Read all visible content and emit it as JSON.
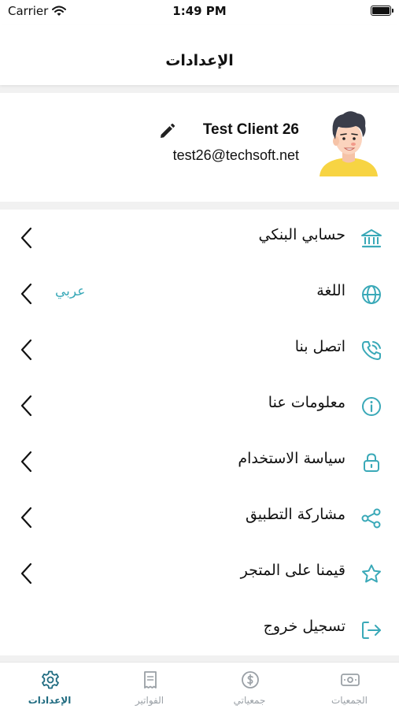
{
  "status_bar": {
    "carrier": "Carrier",
    "time": "1:49 PM"
  },
  "header": {
    "title": "الإعدادات"
  },
  "profile": {
    "name": "Test Client 26",
    "email": "test26@techsoft.net"
  },
  "menu": [
    {
      "label": "حسابي البنكي",
      "icon": "bank-icon"
    },
    {
      "label": "اللغة",
      "value": "عربي",
      "icon": "globe-icon"
    },
    {
      "label": "اتصل بنا",
      "icon": "phone-icon"
    },
    {
      "label": "معلومات عنا",
      "icon": "info-icon"
    },
    {
      "label": "سياسة الاستخدام",
      "icon": "lock-icon"
    },
    {
      "label": "مشاركة التطبيق",
      "icon": "share-icon"
    },
    {
      "label": "قيمنا على المتجر",
      "icon": "star-icon"
    },
    {
      "label": "تسجيل خروج",
      "icon": "logout-icon"
    }
  ],
  "tabs": [
    {
      "label": "الجمعيات",
      "icon": "cash-icon",
      "active": false
    },
    {
      "label": "جمعياتي",
      "icon": "dollar-coin-icon",
      "active": false
    },
    {
      "label": "الفواتير",
      "icon": "receipt-icon",
      "active": false
    },
    {
      "label": "الإعدادات",
      "icon": "gear-icon",
      "active": true
    }
  ],
  "colors": {
    "accent": "#3aa9b8",
    "active_tab": "#1f6b80",
    "inactive_tab": "#9aa0a6"
  }
}
